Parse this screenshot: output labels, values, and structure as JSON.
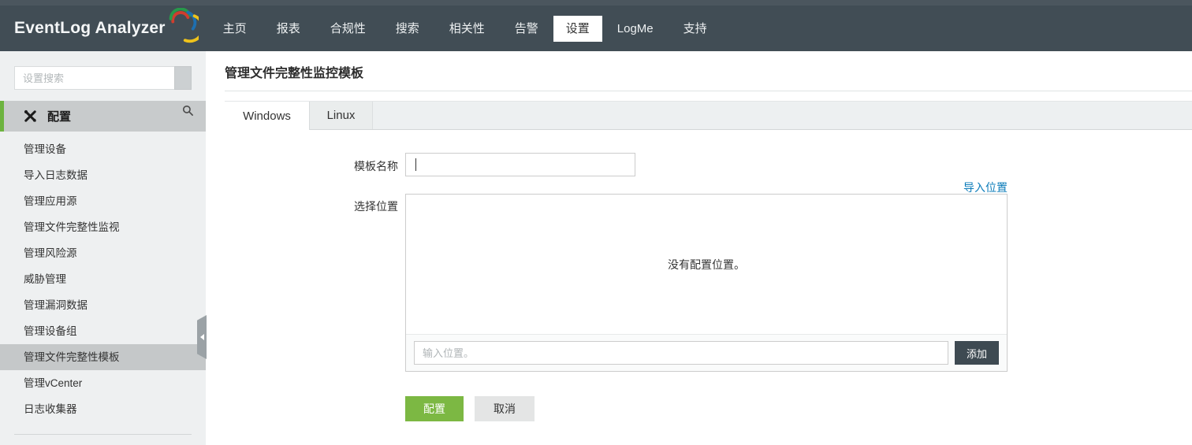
{
  "navbar": {
    "logo": "EventLog Analyzer",
    "items": [
      {
        "label": "主页",
        "active": false
      },
      {
        "label": "报表",
        "active": false
      },
      {
        "label": "合规性",
        "active": false
      },
      {
        "label": "搜索",
        "active": false
      },
      {
        "label": "相关性",
        "active": false
      },
      {
        "label": "告警",
        "active": false
      },
      {
        "label": "设置",
        "active": true
      },
      {
        "label": "LogMe",
        "active": false
      },
      {
        "label": "支持",
        "active": false
      }
    ]
  },
  "sidebar": {
    "search_placeholder": "设置搜索",
    "section_title": "配置",
    "items": [
      {
        "label": "管理设备",
        "selected": false
      },
      {
        "label": "导入日志数据",
        "selected": false
      },
      {
        "label": "管理应用源",
        "selected": false
      },
      {
        "label": "管理文件完整性监视",
        "selected": false
      },
      {
        "label": "管理风险源",
        "selected": false
      },
      {
        "label": "威胁管理",
        "selected": false
      },
      {
        "label": "管理漏洞数据",
        "selected": false
      },
      {
        "label": "管理设备组",
        "selected": false
      },
      {
        "label": "管理文件完整性模板",
        "selected": true
      },
      {
        "label": "管理vCenter",
        "selected": false
      },
      {
        "label": "日志收集器",
        "selected": false
      }
    ]
  },
  "main": {
    "title": "管理文件完整性监控模板",
    "tabs": [
      {
        "label": "Windows",
        "active": true
      },
      {
        "label": "Linux",
        "active": false
      }
    ],
    "form": {
      "template_name_label": "模板名称",
      "template_name_value": "",
      "import_link": "导入位置",
      "select_location_label": "选择位置",
      "empty_message": "没有配置位置。",
      "location_placeholder": "输入位置。",
      "add_button": "添加",
      "submit_button": "配置",
      "cancel_button": "取消"
    }
  },
  "icons": {
    "logo_swirl": "multicolor-arc-swoosh",
    "tools": "crossed-wrench-and-screwdriver",
    "search": "magnifier",
    "collapse": "left-triangle"
  },
  "colors": {
    "navbar": "#414d55",
    "accent_green": "#6db33f",
    "button_green": "#7cb843",
    "link_blue": "#0c7cba",
    "dark_button": "#3e4a52",
    "sidebar_bg": "#eef0f1",
    "selected_item_bg": "#c5c8c9"
  }
}
